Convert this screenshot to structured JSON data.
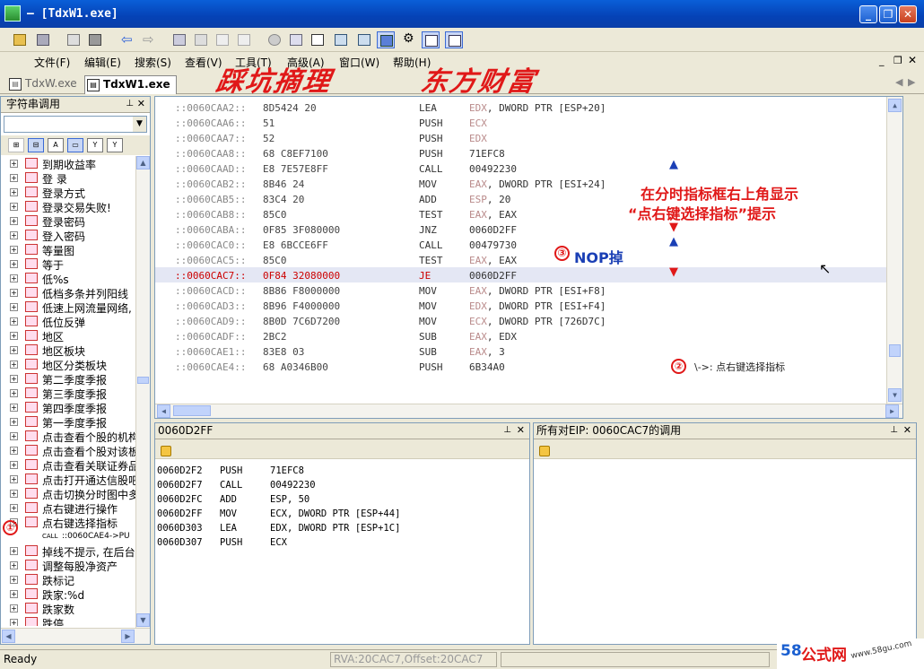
{
  "window": {
    "title": "– [TdxW1.exe]"
  },
  "menu": [
    "文件(F)",
    "编辑(E)",
    "搜索(S)",
    "查看(V)",
    "工具(T)",
    "高级(A)",
    "窗口(W)",
    "帮助(H)"
  ],
  "tabs": [
    {
      "label": "TdxW.exe",
      "active": false
    },
    {
      "label": "TdxW1.exe",
      "active": true
    }
  ],
  "handwritten_banner": {
    "left": "踩坑摘理",
    "right": "东方财富"
  },
  "sidebar": {
    "title": "字符串调用",
    "items": [
      "到期收益率",
      "登 录",
      "登录方式",
      "登录交易失败!",
      "登录密码",
      "登入密码",
      "等量图",
      "等于",
      "低%s",
      "低档多条并列阳线",
      "低速上网流量网络,",
      "低位反弹",
      "地区",
      "地区板块",
      "地区分类板块",
      "第二季度季报",
      "第三季度季报",
      "第四季度季报",
      "第一季度季报",
      "点击查看个股的机构",
      "点击查看个股对该板",
      "点击查看关联证券品",
      "点击打开通达信股吧",
      "点击切换分时图中多",
      "点右键进行操作",
      "点右键选择指标",
      "::0060CAE4->PU",
      "掉线不提示, 在后台",
      "调整每股净资产",
      "跌标记",
      "跌家:%d",
      "跌家数",
      "跌停"
    ],
    "leaf_index": 26,
    "leaf_icon_text": "CALL"
  },
  "disasm": {
    "lines": [
      {
        "addr": "::0060CAA2::",
        "hex": "8D5424 20",
        "mn": "LEA",
        "reg": "EDX",
        "rest": ", DWORD PTR [ESP+20]"
      },
      {
        "addr": "::0060CAA6::",
        "hex": "51",
        "mn": "PUSH",
        "reg": "ECX",
        "rest": ""
      },
      {
        "addr": "::0060CAA7::",
        "hex": "52",
        "mn": "PUSH",
        "reg": "EDX",
        "rest": ""
      },
      {
        "addr": "::0060CAA8::",
        "hex": "68 C8EF7100",
        "mn": "PUSH",
        "reg": "",
        "rest": "71EFC8"
      },
      {
        "addr": "::0060CAAD::",
        "hex": "E8 7E57E8FF",
        "mn": "CALL",
        "reg": "",
        "rest": "00492230"
      },
      {
        "addr": "::0060CAB2::",
        "hex": "8B46 24",
        "mn": "MOV",
        "reg": "EAX",
        "rest": ", DWORD PTR [ESI+24]"
      },
      {
        "addr": "::0060CAB5::",
        "hex": "83C4 20",
        "mn": "ADD",
        "reg": "ESP",
        "rest": ", 20"
      },
      {
        "addr": "::0060CAB8::",
        "hex": "85C0",
        "mn": "TEST",
        "reg": "EAX",
        "rest": ", EAX"
      },
      {
        "addr": "::0060CABA::",
        "hex": "0F85 3F080000",
        "mn": "JNZ",
        "reg": "",
        "rest": "0060D2FF"
      },
      {
        "addr": "::0060CAC0::",
        "hex": "E8 6BCCE6FF",
        "mn": "CALL",
        "reg": "",
        "rest": "00479730"
      },
      {
        "addr": "::0060CAC5::",
        "hex": "85C0",
        "mn": "TEST",
        "reg": "EAX",
        "rest": ", EAX"
      },
      {
        "addr": "::0060CAC7::",
        "hex": "0F84 32080000",
        "mn": "JE",
        "reg": "",
        "rest": "0060D2FF"
      },
      {
        "addr": "::0060CACD::",
        "hex": "8B86 F8000000",
        "mn": "MOV",
        "reg": "EAX",
        "rest": ", DWORD PTR [ESI+F8]"
      },
      {
        "addr": "::0060CAD3::",
        "hex": "8B96 F4000000",
        "mn": "MOV",
        "reg": "EDX",
        "rest": ", DWORD PTR [ESI+F4]"
      },
      {
        "addr": "::0060CAD9::",
        "hex": "8B0D 7C6D7200",
        "mn": "MOV",
        "reg": "ECX",
        "rest": ", DWORD PTR [726D7C]"
      },
      {
        "addr": "::0060CADF::",
        "hex": "2BC2",
        "mn": "SUB",
        "reg": "EAX",
        "rest": ", EDX"
      },
      {
        "addr": "::0060CAE1::",
        "hex": "83E8 03",
        "mn": "SUB",
        "reg": "EAX",
        "rest": ", 3"
      },
      {
        "addr": "::0060CAE4::",
        "hex": "68 A0346B00",
        "mn": "PUSH",
        "reg": "",
        "rest": "6B34A0"
      }
    ],
    "selected_index": 11,
    "note_box": {
      "line1": "在分时指标框右上角显示",
      "line2": "“点右键选择指标”提示"
    },
    "nop_note": "NOP掉",
    "nop_circle": "③",
    "hint2_circle": "②",
    "hint2_text": "\\->: 点右键选择指标"
  },
  "stack": {
    "title": "0060D2FF",
    "lines": [
      {
        "addr": "0060D2F2",
        "mn": "PUSH",
        "op": "71EFC8"
      },
      {
        "addr": "0060D2F7",
        "mn": "CALL",
        "op": "00492230"
      },
      {
        "addr": "0060D2FC",
        "mn": "ADD",
        "op": "ESP, 50"
      },
      {
        "addr": "0060D2FF",
        "mn": "MOV",
        "op": "ECX, DWORD PTR [ESP+44]"
      },
      {
        "addr": "0060D303",
        "mn": "LEA",
        "op": "EDX, DWORD PTR [ESP+1C]"
      },
      {
        "addr": "0060D307",
        "mn": "PUSH",
        "op": "ECX"
      }
    ]
  },
  "refs": {
    "title": "所有对EIP: 0060CAC7的调用"
  },
  "sidebar_circle": "①",
  "status": {
    "left": "Ready",
    "mid": "RVA:20CAC7,Offset:20CAC7"
  },
  "watermark": {
    "brand_num": "58",
    "brand_text": "公式网",
    "url": "www.58gu.com"
  },
  "colors": {
    "titlebar": "#0542b6",
    "annotation_red": "#e01818",
    "note_blue": "#1a3fb5",
    "selected_row": "#e4e7f4"
  }
}
